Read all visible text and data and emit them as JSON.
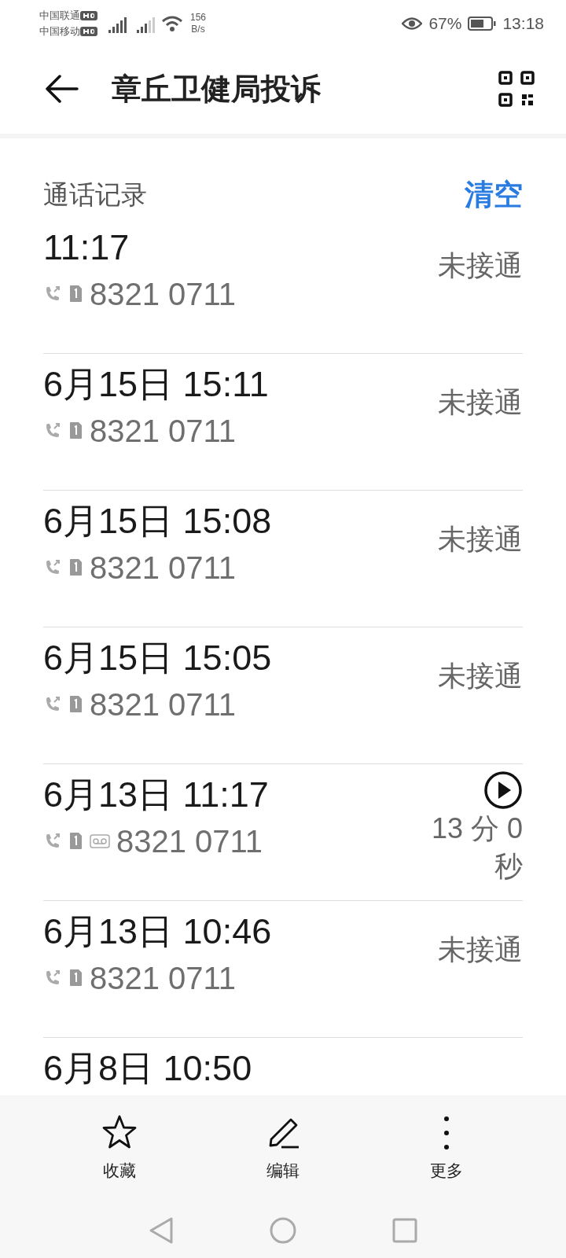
{
  "status_bar": {
    "carriers": [
      "中国联通",
      "中国移动"
    ],
    "speed": [
      "156",
      "B/s"
    ],
    "battery": "67%",
    "time": "13:18"
  },
  "header": {
    "title": "章丘卫健局投诉"
  },
  "section": {
    "title": "通话记录",
    "action": "清空"
  },
  "calls": [
    {
      "kind": "missed",
      "time": "11:17",
      "number": "8321 0711",
      "result": "未接通"
    },
    {
      "kind": "missed",
      "time": "6月15日 15:11",
      "number": "8321 0711",
      "result": "未接通"
    },
    {
      "kind": "missed",
      "time": "6月15日 15:08",
      "number": "8321 0711",
      "result": "未接通"
    },
    {
      "kind": "missed",
      "time": "6月15日 15:05",
      "number": "8321 0711",
      "result": "未接通"
    },
    {
      "kind": "recorded",
      "time": "6月13日 11:17",
      "number": "8321 0711",
      "result": "13 分 0 秒"
    },
    {
      "kind": "missed",
      "time": "6月13日 10:46",
      "number": "8321 0711",
      "result": "未接通"
    },
    {
      "kind": "partial",
      "time": "6月8日 10:50"
    }
  ],
  "actions": [
    {
      "kind": "star",
      "label": "收藏"
    },
    {
      "kind": "pencil",
      "label": "编辑"
    },
    {
      "kind": "more",
      "label": "更多"
    }
  ]
}
